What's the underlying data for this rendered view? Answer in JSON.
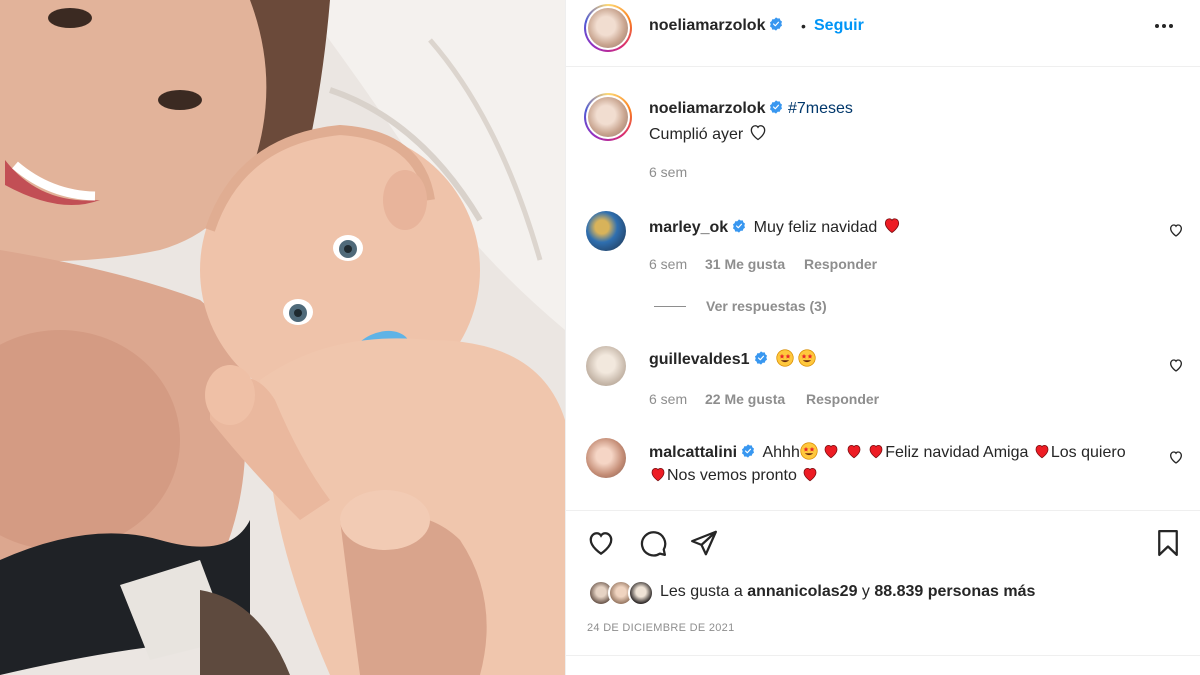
{
  "post": {
    "username": "noeliamarzolok",
    "follow_label": "Seguir",
    "separator": "•",
    "caption_hashtag": "#7meses",
    "caption_text": "Cumplió ayer",
    "caption_age": "6 sem"
  },
  "comments": [
    {
      "username": "marley_ok",
      "text": "Muy feliz navidad",
      "age": "6 sem",
      "likes": "31 Me gusta",
      "reply_label": "Responder",
      "view_replies": "Ver respuestas (3)"
    },
    {
      "username": "guillevaldes1",
      "age": "6 sem",
      "likes": "22 Me gusta",
      "reply_label": "Responder"
    },
    {
      "username": "malcattalini",
      "text_1": "Ahhh",
      "text_2": "Feliz navidad Amiga",
      "text_3": "Los",
      "text_4": "quiero",
      "text_5": "Nos vemos pronto"
    }
  ],
  "likes": {
    "prefix": "Les gusta a",
    "user": "annanicolas29",
    "middle": "y",
    "count": "88.839 personas más"
  },
  "date": "24 DE DICIEMBRE DE 2021",
  "icons": {
    "like": "heart-icon",
    "comment": "comment-icon",
    "share": "send-icon",
    "save": "bookmark-icon",
    "verified": "verified-badge-icon",
    "more": "more-options-icon"
  },
  "colors": {
    "accent": "#0095f6",
    "verified": "#3897f0",
    "heart_red": "#ed1c24",
    "secondary_text": "#8e8e8e"
  }
}
